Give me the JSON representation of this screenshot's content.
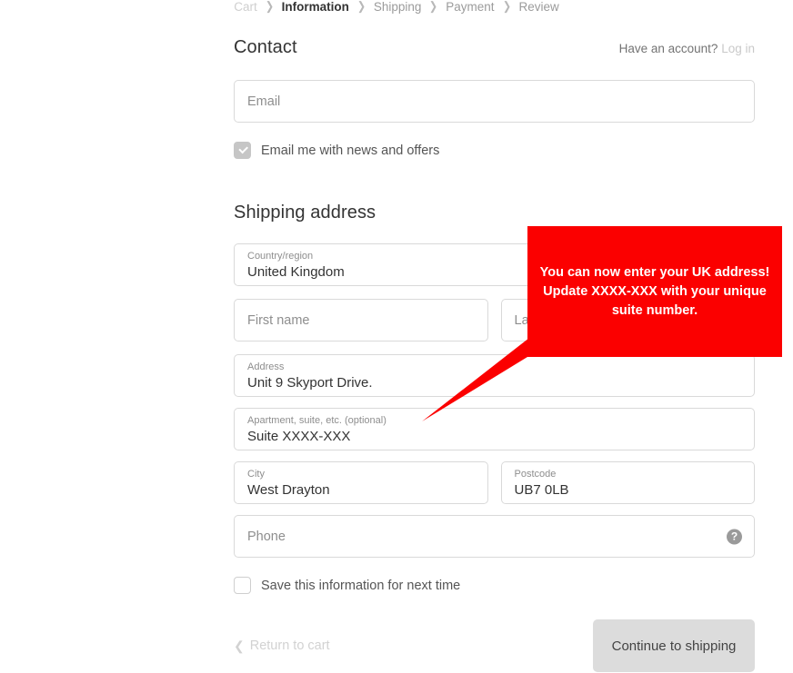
{
  "breadcrumb": {
    "separator": "❯",
    "items": [
      {
        "label": "Cart",
        "state": "muted"
      },
      {
        "label": "Information",
        "state": "active"
      },
      {
        "label": "Shipping",
        "state": "normal"
      },
      {
        "label": "Payment",
        "state": "normal"
      },
      {
        "label": "Review",
        "state": "normal"
      }
    ]
  },
  "contact": {
    "title": "Contact",
    "account_prompt": "Have an account?",
    "login_label": "Log in",
    "email_placeholder": "Email",
    "email_value": "",
    "news_offers_label": "Email me with news and offers",
    "news_offers_checked": true
  },
  "shipping": {
    "title": "Shipping address",
    "country": {
      "label": "Country/region",
      "value": "United Kingdom"
    },
    "first_name": {
      "placeholder": "First name",
      "value": ""
    },
    "last_name": {
      "placeholder": "Last name",
      "value": ""
    },
    "address": {
      "label": "Address",
      "value": "Unit 9 Skyport Drive."
    },
    "apartment": {
      "label": "Apartment, suite, etc. (optional)",
      "value": "Suite XXXX-XXX"
    },
    "city": {
      "label": "City",
      "value": "West Drayton"
    },
    "postcode": {
      "label": "Postcode",
      "value": "UB7 0LB"
    },
    "phone": {
      "placeholder": "Phone",
      "value": "",
      "help_icon": "?"
    },
    "save_info_label": "Save this information for next time",
    "save_info_checked": false
  },
  "footer": {
    "return_chevron": "❮",
    "return_label": "Return to cart",
    "continue_label": "Continue to shipping"
  },
  "callout": {
    "text": "You can now enter your UK address! Update XXXX-XXX with your unique suite number.",
    "color": "#FB0000",
    "text_color": "#FFFFFF"
  }
}
